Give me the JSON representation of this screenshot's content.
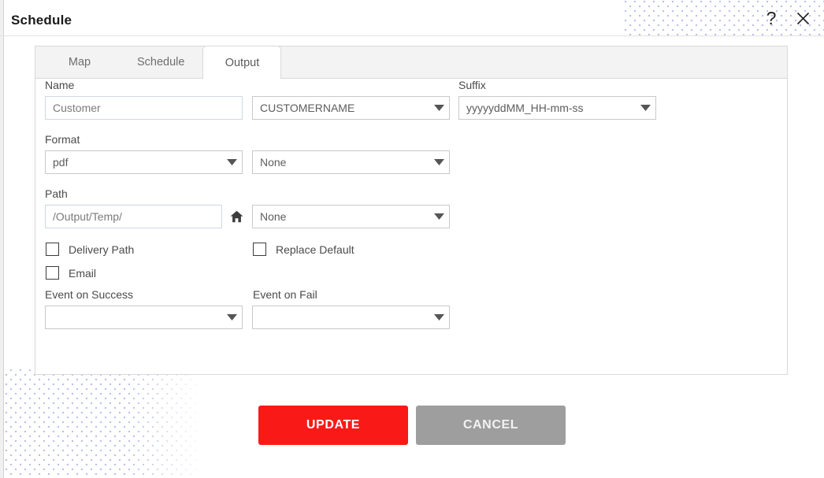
{
  "header": {
    "title": "Schedule",
    "help_icon": "question-mark-icon",
    "close_icon": "close-icon"
  },
  "tabs": [
    {
      "label": "Map",
      "active": false
    },
    {
      "label": "Schedule",
      "active": false
    },
    {
      "label": "Output",
      "active": true
    }
  ],
  "form": {
    "name": {
      "label": "Name",
      "text_value": "Customer",
      "token_value": "CUSTOMERNAME"
    },
    "suffix": {
      "label": "Suffix",
      "value": "yyyyyddMM_HH-mm-ss"
    },
    "format": {
      "label": "Format",
      "value": "pdf",
      "secondary_value": "None"
    },
    "path": {
      "label": "Path",
      "value": "/Output/Temp/",
      "home_icon": "home-icon",
      "secondary_value": "None"
    },
    "checkboxes": [
      {
        "label": "Delivery Path",
        "checked": false
      },
      {
        "label": "Replace Default",
        "checked": false
      },
      {
        "label": "Email",
        "checked": false
      }
    ],
    "event_on_success": {
      "label": "Event on Success",
      "value": ""
    },
    "event_on_fail": {
      "label": "Event on Fail",
      "value": ""
    }
  },
  "footer": {
    "update_label": "UPDATE",
    "cancel_label": "CANCEL"
  },
  "colors": {
    "update_red": "#f91a17",
    "cancel_gray": "#9e9e9e",
    "dot_pattern": "#b9c0e8"
  }
}
